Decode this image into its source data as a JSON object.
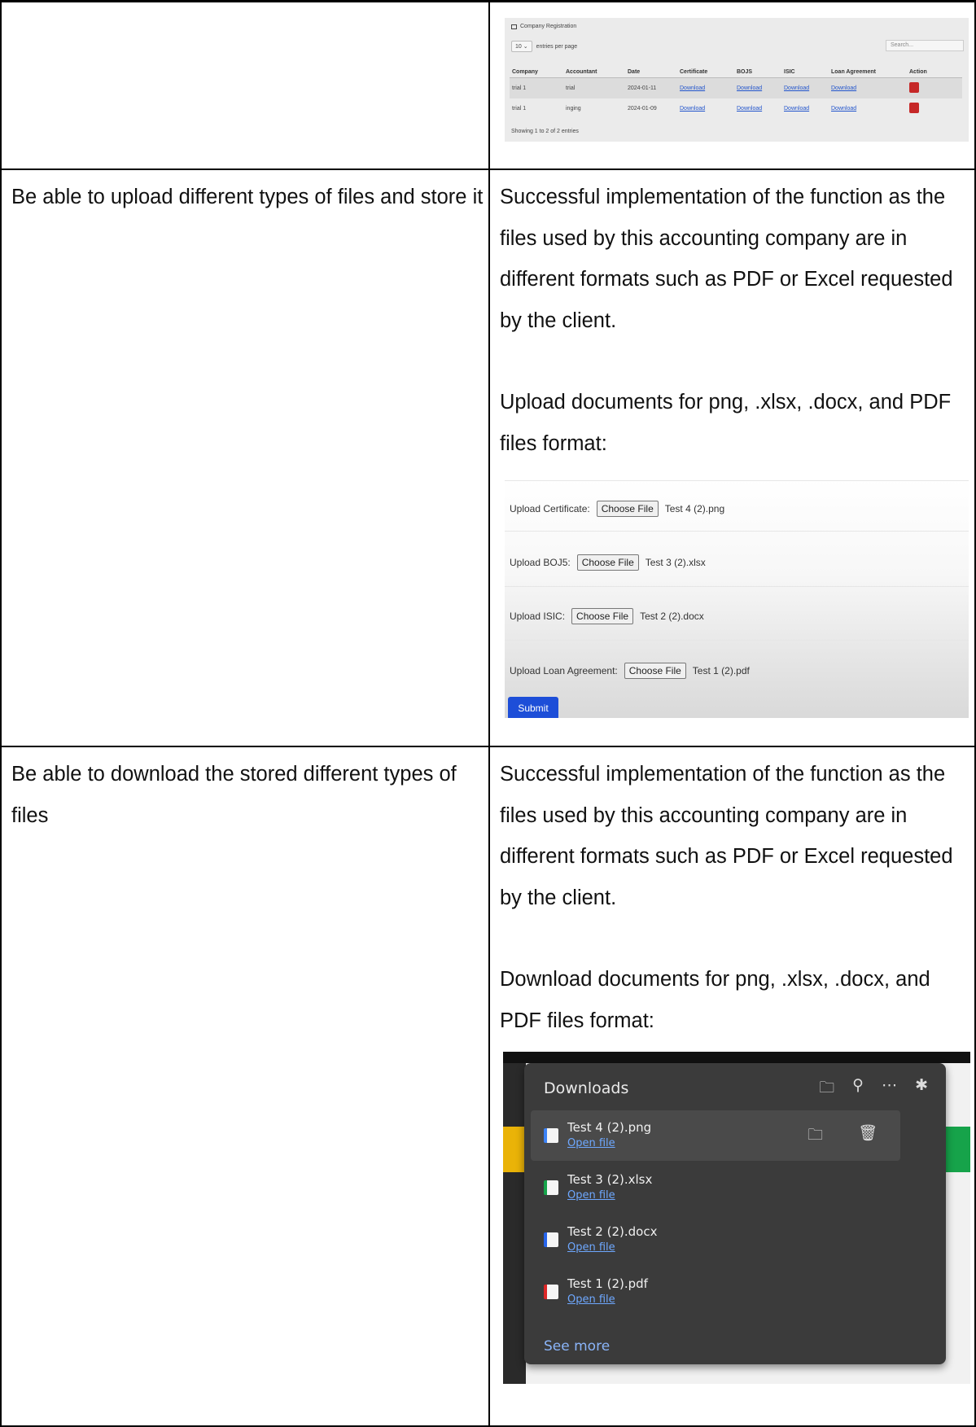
{
  "rows": [
    {
      "requirement": "",
      "result_paragraphs": []
    },
    {
      "requirement": "Be able to upload different types of files and store it",
      "result_paragraphs": [
        "Successful implementation of the function as the files used by this accounting company are in different formats such as PDF or Excel requested by the client.",
        "Upload documents for png, .xlsx, .docx, and PDF files format:"
      ]
    },
    {
      "requirement": "Be able to download the stored different types of files",
      "result_paragraphs": [
        "Successful implementation of the function as the files used by this accounting company are in different formats such as PDF or Excel requested by the client.",
        "Download documents for png, .xlsx, .docx, and PDF files format:"
      ]
    }
  ],
  "company_registration": {
    "title": "Company Registration",
    "per_page_value": "10 ⌄",
    "per_page_label": "entries per page",
    "search_placeholder": "Search...",
    "columns": [
      "Company",
      "Accountant",
      "Date",
      "Certificate",
      "BOJS",
      "ISIC",
      "Loan Agreement",
      "Action"
    ],
    "rows": [
      {
        "company": "trial 1",
        "accountant": "trial",
        "date": "2024-01-11",
        "certificate": "Download",
        "bojs": "Download",
        "isic": "Download",
        "loan": "Download"
      },
      {
        "company": "trial 1",
        "accountant": "inging",
        "date": "2024-01-09",
        "certificate": "Download",
        "bojs": "Download",
        "isic": "Download",
        "loan": "Download"
      }
    ],
    "footer": "Showing 1 to 2 of 2 entries"
  },
  "upload_form": {
    "choose_label": "Choose File",
    "fields": [
      {
        "label": "Upload Certificate:",
        "file": "Test 4 (2).png"
      },
      {
        "label": "Upload BOJ5:",
        "file": "Test 3 (2).xlsx"
      },
      {
        "label": "Upload ISIC:",
        "file": "Test 2 (2).docx"
      },
      {
        "label": "Upload Loan Agreement:",
        "file": "Test 1 (2).pdf"
      }
    ],
    "submit_label": "Submit"
  },
  "downloads_panel": {
    "title": "Downloads",
    "header_icons": [
      "folder-icon",
      "search-icon",
      "more-icon",
      "pin-icon"
    ],
    "items": [
      {
        "name": "Test 4 (2).png",
        "link": "Open file",
        "icon_color": "#3b82f6"
      },
      {
        "name": "Test 3 (2).xlsx",
        "link": "Open file",
        "icon_color": "#16a34a"
      },
      {
        "name": "Test 2 (2).docx",
        "link": "Open file",
        "icon_color": "#2563eb"
      },
      {
        "name": "Test 1 (2).pdf",
        "link": "Open file",
        "icon_color": "#dc2626"
      }
    ],
    "see_more": "See more"
  }
}
